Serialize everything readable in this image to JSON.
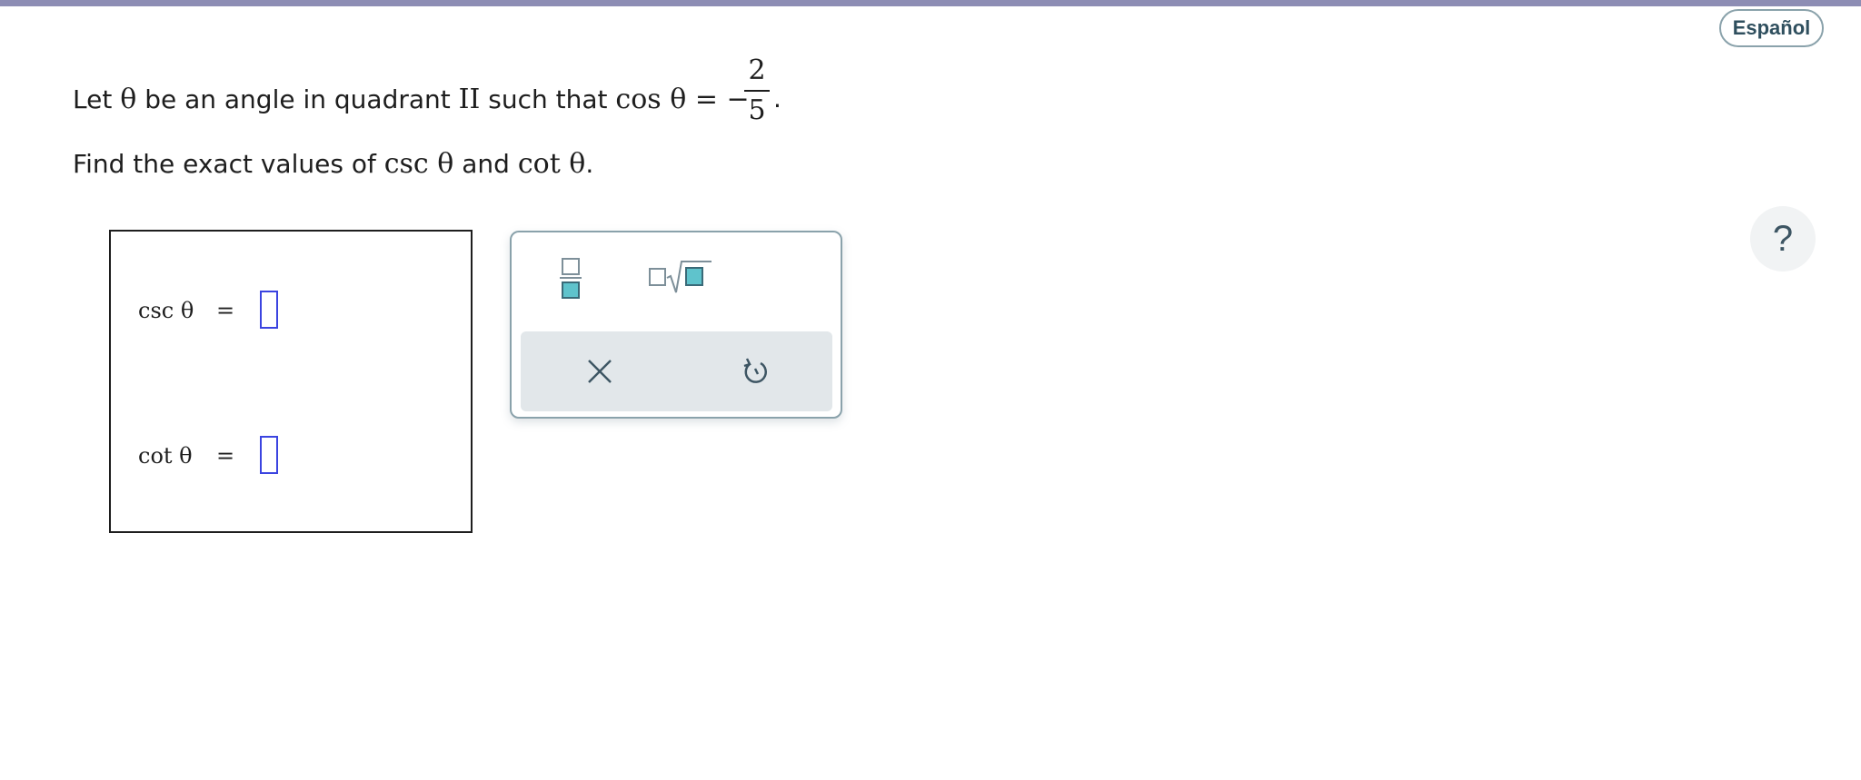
{
  "header": {
    "language_button": "Español"
  },
  "problem": {
    "line1_prefix": "Let",
    "theta": "θ",
    "line1_middle": "be an angle in quadrant",
    "quadrant": "II",
    "line1_suffix": "such that",
    "cos_expr": "cos θ = −",
    "fraction_numerator": "2",
    "fraction_denominator": "5",
    "period": ".",
    "line2_prefix": "Find the exact values of",
    "csc_expr": "csc θ",
    "line2_and": "and",
    "cot_expr": "cot θ",
    "line2_suffix": "."
  },
  "answers": {
    "rows": [
      {
        "label": "csc θ",
        "equals": "=",
        "value": ""
      },
      {
        "label": "cot θ",
        "equals": "=",
        "value": ""
      }
    ]
  },
  "palette": {
    "tools": [
      "fraction-icon",
      "mixed-radical-icon"
    ],
    "actions": [
      "clear-icon",
      "undo-icon"
    ]
  },
  "help": {
    "label": "?"
  },
  "colors": {
    "top_bar": "#8d8db4",
    "input_border": "#3b44e0",
    "teal_accent": "#5fc3cc",
    "action_bg": "#e2e7ea"
  }
}
